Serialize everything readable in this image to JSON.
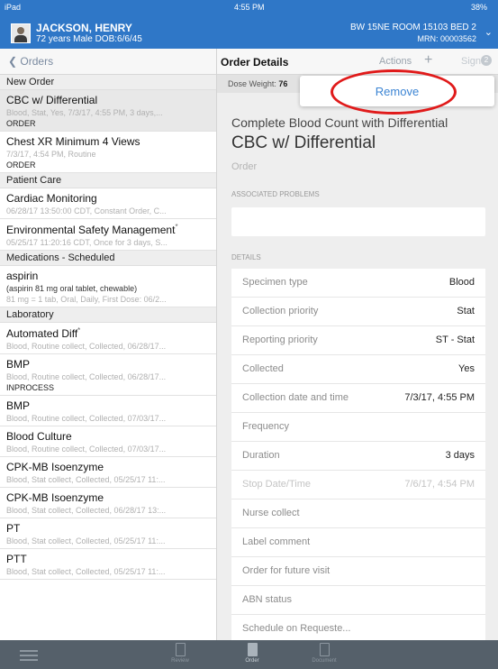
{
  "status": {
    "carrier": "iPad",
    "time": "4:55 PM",
    "battery": "38%"
  },
  "patient": {
    "name": "JACKSON, HENRY",
    "info": "72 years  Male  DOB:6/6/45",
    "room": "BW 15NE ROOM 15103 BED 2",
    "mrn": "MRN: 00003562"
  },
  "left_nav": {
    "back_label": "Orders"
  },
  "sections": [
    {
      "title": "New Order",
      "items": [
        {
          "title": "CBC w/ Differential",
          "sub": "Blood, Stat, Yes, 7/3/17, 4:55 PM, 3 days,...",
          "status": "ORDER",
          "selected": true
        },
        {
          "title": "Chest XR Minimum 4 Views",
          "sub": "7/3/17, 4:54 PM, Routine",
          "status": "ORDER"
        }
      ]
    },
    {
      "title": "Patient Care",
      "items": [
        {
          "title": "Cardiac Monitoring",
          "sub": "06/28/17 13:50:00 CDT, Constant Order, C..."
        },
        {
          "title": "Environmental Safety Management",
          "flag": "*",
          "sub": "05/25/17 11:20:16 CDT, Once for 3 days, S..."
        }
      ]
    },
    {
      "title": "Medications - Scheduled",
      "items": [
        {
          "title": "aspirin",
          "sub_dark": "(aspirin 81 mg oral tablet, chewable)",
          "sub": "81 mg = 1 tab, Oral, Daily, First Dose: 06/2..."
        }
      ]
    },
    {
      "title": "Laboratory",
      "items": [
        {
          "title": "Automated Diff",
          "flag": "*",
          "sub": "Blood, Routine collect, Collected, 06/28/17..."
        },
        {
          "title": "BMP",
          "sub": "Blood, Routine collect, Collected, 06/28/17...",
          "status": "INPROCESS"
        },
        {
          "title": "BMP",
          "sub": "Blood, Routine collect, Collected, 07/03/17..."
        },
        {
          "title": "Blood Culture",
          "sub": "Blood, Routine collect, Collected, 07/03/17..."
        },
        {
          "title": "CPK-MB Isoenzyme",
          "sub": "Blood, Stat collect, Collected, 05/25/17 11:..."
        },
        {
          "title": "CPK-MB Isoenzyme",
          "sub": "Blood, Stat collect, Collected, 06/28/17 13:..."
        },
        {
          "title": "PT",
          "sub": "Blood, Stat collect, Collected, 05/25/17 11:..."
        },
        {
          "title": "PTT",
          "sub": "Blood, Stat collect, Collected, 05/25/17 11:..."
        }
      ]
    }
  ],
  "detail": {
    "nav_title": "Order Details",
    "actions_label": "Actions",
    "plus_label": "+",
    "sign_label": "Sign",
    "sign_count": "2",
    "dose_label": "Dose Weight:",
    "dose_value": "76",
    "menu": {
      "remove_label": "Remove"
    },
    "order_title": "Complete Blood Count with Differential",
    "order_name": "CBC w/ Differential",
    "order_type": "Order",
    "associated_label": "ASSOCIATED PROBLEMS",
    "details_label": "DETAILS",
    "rows": [
      {
        "label": "Specimen type",
        "value": "Blood"
      },
      {
        "label": "Collection priority",
        "value": "Stat"
      },
      {
        "label": "Reporting priority",
        "value": "ST - Stat"
      },
      {
        "label": "Collected",
        "value": "Yes"
      },
      {
        "label": "Collection date and time",
        "value": "7/3/17, 4:55 PM"
      },
      {
        "label": "Frequency",
        "value": ""
      },
      {
        "label": "Duration",
        "value": "3 days"
      },
      {
        "label": "Stop Date/Time",
        "value": "7/6/17, 4:54 PM",
        "muted": true
      },
      {
        "label": "Nurse collect",
        "value": ""
      },
      {
        "label": "Label comment",
        "value": ""
      },
      {
        "label": "Order for future visit",
        "value": ""
      },
      {
        "label": "ABN status",
        "value": ""
      },
      {
        "label": "Schedule on Requeste...",
        "value": ""
      }
    ]
  },
  "tabbar": {
    "review_label": "Review",
    "order_label": "Order",
    "document_label": "Document"
  }
}
